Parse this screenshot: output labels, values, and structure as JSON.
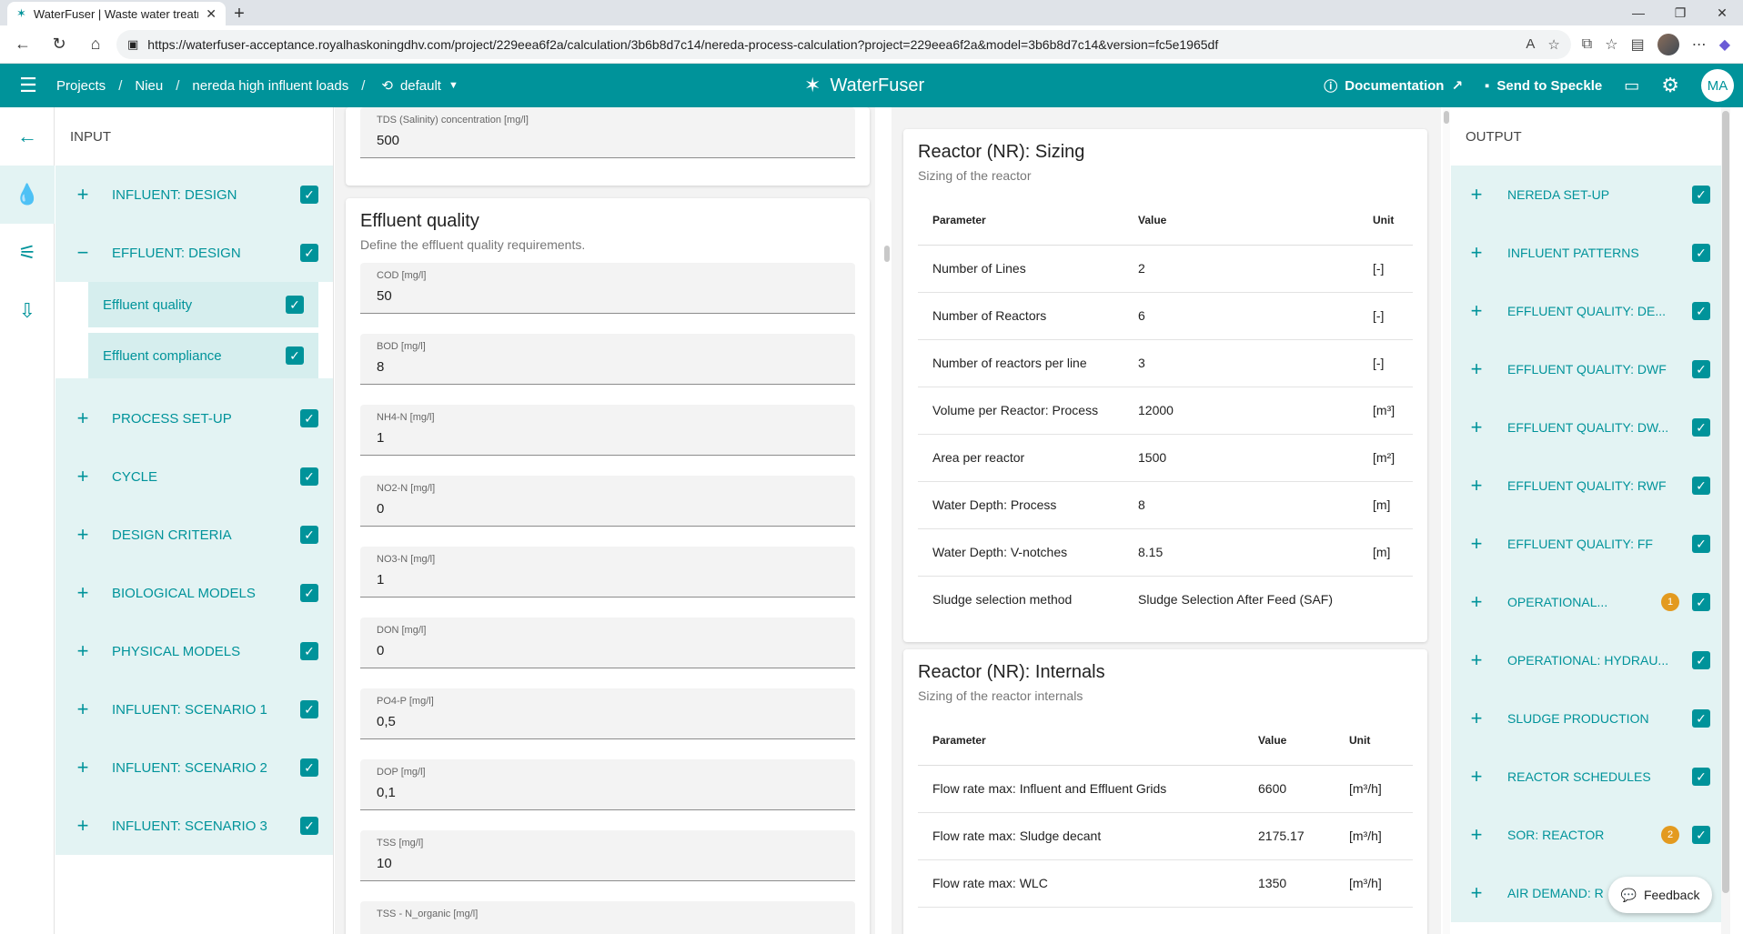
{
  "browser": {
    "tab_title": "WaterFuser | Waste water treatme",
    "url": "https://waterfuser-acceptance.royalhaskoningdhv.com/project/229eea6f2a/calculation/3b6b8d7c14/nereda-process-calculation?project=229eea6f2a&model=3b6b8d7c14&version=fc5e1965df"
  },
  "header": {
    "breadcrumb": [
      "Projects",
      "Nieu",
      "nereda high influent loads"
    ],
    "version": "default",
    "brand": "WaterFuser",
    "documentation": "Documentation",
    "send_to_speckle": "Send to Speckle",
    "user_initials": "MA"
  },
  "input_panel": {
    "title": "INPUT",
    "items": [
      {
        "label": "INFLUENT: DESIGN",
        "expanded": false
      },
      {
        "label": "EFFLUENT: DESIGN",
        "expanded": true
      },
      {
        "label": "PROCESS SET-UP",
        "expanded": false
      },
      {
        "label": "CYCLE",
        "expanded": false
      },
      {
        "label": "DESIGN CRITERIA",
        "expanded": false
      },
      {
        "label": "BIOLOGICAL MODELS",
        "expanded": false
      },
      {
        "label": "PHYSICAL MODELS",
        "expanded": false
      },
      {
        "label": "INFLUENT: SCENARIO 1",
        "expanded": false
      },
      {
        "label": "INFLUENT: SCENARIO 2",
        "expanded": false
      },
      {
        "label": "INFLUENT: SCENARIO 3",
        "expanded": false
      }
    ],
    "sub_items": [
      "Effluent quality",
      "Effluent compliance"
    ]
  },
  "form": {
    "top_field": {
      "label": "TDS (Salinity) concentration [mg/l]",
      "value": "500"
    },
    "section_title": "Effluent quality",
    "section_subtitle": "Define the effluent quality requirements.",
    "fields": [
      {
        "label": "COD [mg/l]",
        "value": "50"
      },
      {
        "label": "BOD [mg/l]",
        "value": "8"
      },
      {
        "label": "NH4-N [mg/l]",
        "value": "1"
      },
      {
        "label": "NO2-N [mg/l]",
        "value": "0"
      },
      {
        "label": "NO3-N [mg/l]",
        "value": "1"
      },
      {
        "label": "DON [mg/l]",
        "value": "0"
      },
      {
        "label": "PO4-P [mg/l]",
        "value": "0,5"
      },
      {
        "label": "DOP [mg/l]",
        "value": "0,1"
      },
      {
        "label": "TSS [mg/l]",
        "value": "10"
      },
      {
        "label": "TSS - N_organic [mg/l]",
        "value": ""
      }
    ]
  },
  "results": {
    "sizing": {
      "title": "Reactor (NR): Sizing",
      "subtitle": "Sizing of the reactor",
      "headers": [
        "Parameter",
        "Value",
        "Unit"
      ],
      "rows": [
        [
          "Number of Lines",
          "2",
          "[-]"
        ],
        [
          "Number of Reactors",
          "6",
          "[-]"
        ],
        [
          "Number of reactors per line",
          "3",
          "[-]"
        ],
        [
          "Volume per Reactor: Process",
          "12000",
          "[m³]"
        ],
        [
          "Area per reactor",
          "1500",
          "[m²]"
        ],
        [
          "Water Depth: Process",
          "8",
          "[m]"
        ],
        [
          "Water Depth: V-notches",
          "8.15",
          "[m]"
        ],
        [
          "Sludge selection method",
          "Sludge Selection After Feed (SAF)",
          ""
        ]
      ]
    },
    "internals": {
      "title": "Reactor (NR): Internals",
      "subtitle": "Sizing of the reactor internals",
      "headers": [
        "Parameter",
        "Value",
        "Unit"
      ],
      "rows": [
        [
          "Flow rate max: Influent and Effluent Grids",
          "6600",
          "[m³/h]"
        ],
        [
          "Flow rate max: Sludge decant",
          "2175.17",
          "[m³/h]"
        ],
        [
          "Flow rate max: WLC",
          "1350",
          "[m³/h]"
        ]
      ]
    }
  },
  "output_panel": {
    "title": "OUTPUT",
    "items": [
      {
        "label": "NEREDA SET-UP",
        "badge": ""
      },
      {
        "label": "INFLUENT PATTERNS",
        "badge": ""
      },
      {
        "label": "EFFLUENT QUALITY: DE...",
        "badge": ""
      },
      {
        "label": "EFFLUENT QUALITY: DWF",
        "badge": ""
      },
      {
        "label": "EFFLUENT QUALITY: DW...",
        "badge": ""
      },
      {
        "label": "EFFLUENT QUALITY: RWF",
        "badge": ""
      },
      {
        "label": "EFFLUENT QUALITY: FF",
        "badge": ""
      },
      {
        "label": "OPERATIONAL...",
        "badge": "1"
      },
      {
        "label": "OPERATIONAL: HYDRAU...",
        "badge": ""
      },
      {
        "label": "SLUDGE PRODUCTION",
        "badge": ""
      },
      {
        "label": "REACTOR SCHEDULES",
        "badge": ""
      },
      {
        "label": "SOR: REACTOR",
        "badge": "2"
      },
      {
        "label": "AIR DEMAND: R",
        "badge": ""
      }
    ]
  },
  "feedback": "Feedback",
  "colors": {
    "accent": "#00939a",
    "warning": "#e39a1f",
    "highlight_bg": "#e3f3f3"
  }
}
